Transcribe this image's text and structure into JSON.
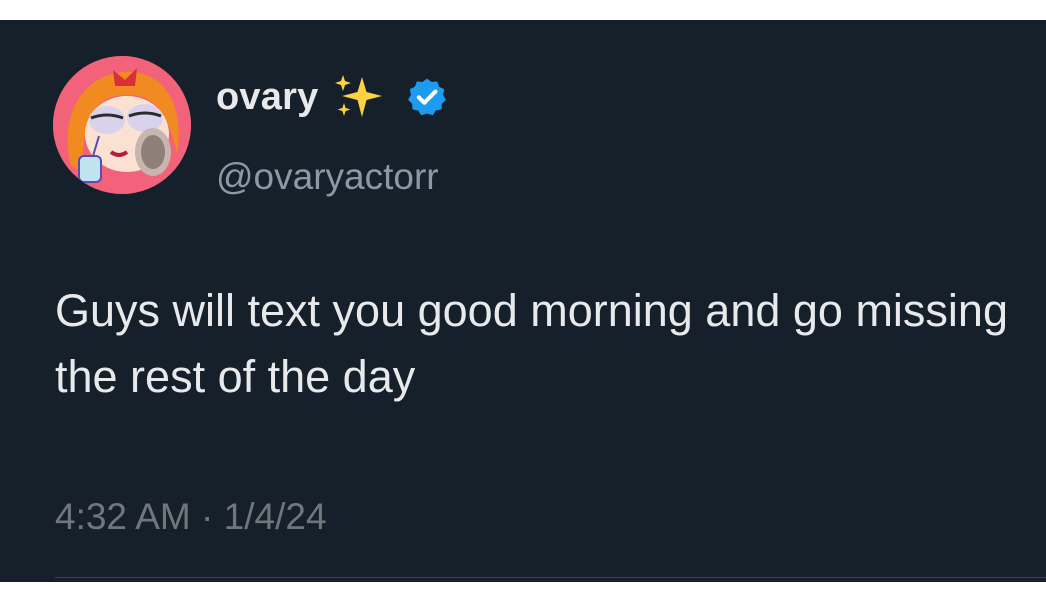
{
  "user": {
    "display_name": "ovary",
    "handle": "@ovaryactorr",
    "avatar_icon": "avatar-cartoon-girl",
    "name_emoji_icon": "sparkles-icon",
    "verified_icon": "verified-badge-icon",
    "verified_color": "#1d9bf0"
  },
  "tweet": {
    "text": "Guys will text you good morning and go missing the rest of the day",
    "time": "4:32 AM",
    "separator": " · ",
    "date": "1/4/24"
  },
  "colors": {
    "background": "#15202b",
    "primary_text": "#e7e9ea",
    "secondary_text": "#71767b",
    "sparkle": "#ffd23f",
    "avatar_bg": "#f2627b"
  }
}
